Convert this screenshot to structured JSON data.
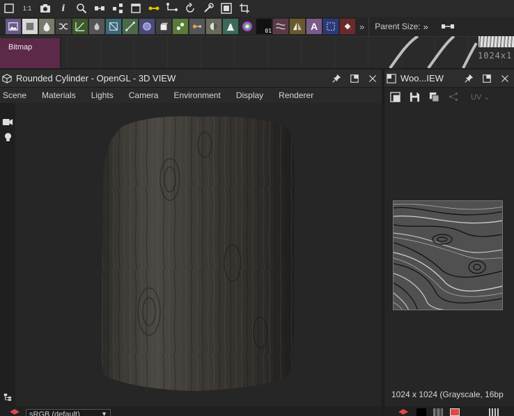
{
  "toolbar_top": {
    "zoom_label": "1:1",
    "icons": [
      "fit-icon",
      "zoom-1to1-icon",
      "camera-icon",
      "info-icon",
      "search-icon",
      "node-icon",
      "tree-icon",
      "frame-icon",
      "connect-icon",
      "link-icon",
      "refresh-icon",
      "wrench-icon",
      "preview-icon",
      "crop-icon"
    ]
  },
  "node_toolbar": {
    "icons": [
      "image-node-icon",
      "uniform-color-icon",
      "grayscale-icon",
      "shuffle-icon",
      "curve-icon",
      "blend-icon",
      "transform-icon",
      "gradient-icon",
      "circle-icon",
      "cube-icon",
      "fx-icon",
      "mix-icon",
      "levels-icon",
      "histogram-icon",
      "color-wheel-icon",
      "noise-icon",
      "warp-icon",
      "mirror-icon",
      "text-icon",
      "select-icon",
      "fill-icon"
    ],
    "text_node": "A",
    "noise_badge": "01",
    "overflow_label": "»",
    "parent_size_label": "Parent Size:",
    "parent_size_chevron": "»"
  },
  "graph": {
    "node_label": "Bitmap",
    "thumb_size": "1024x1"
  },
  "view3d": {
    "title": "Rounded Cylinder - OpenGL - 3D VIEW",
    "menu": [
      "Scene",
      "Materials",
      "Lights",
      "Camera",
      "Environment",
      "Display",
      "Renderer"
    ],
    "colorspace": "sRGB (default)"
  },
  "view2d": {
    "title": "Woo...IEW",
    "uv_label": "UV",
    "info": "1024 x 1024 (Grayscale, 16bp"
  },
  "colors": {
    "bitmap_node": "#5c2a48",
    "background": "#262626",
    "accent_yellow": "#e8c000"
  }
}
